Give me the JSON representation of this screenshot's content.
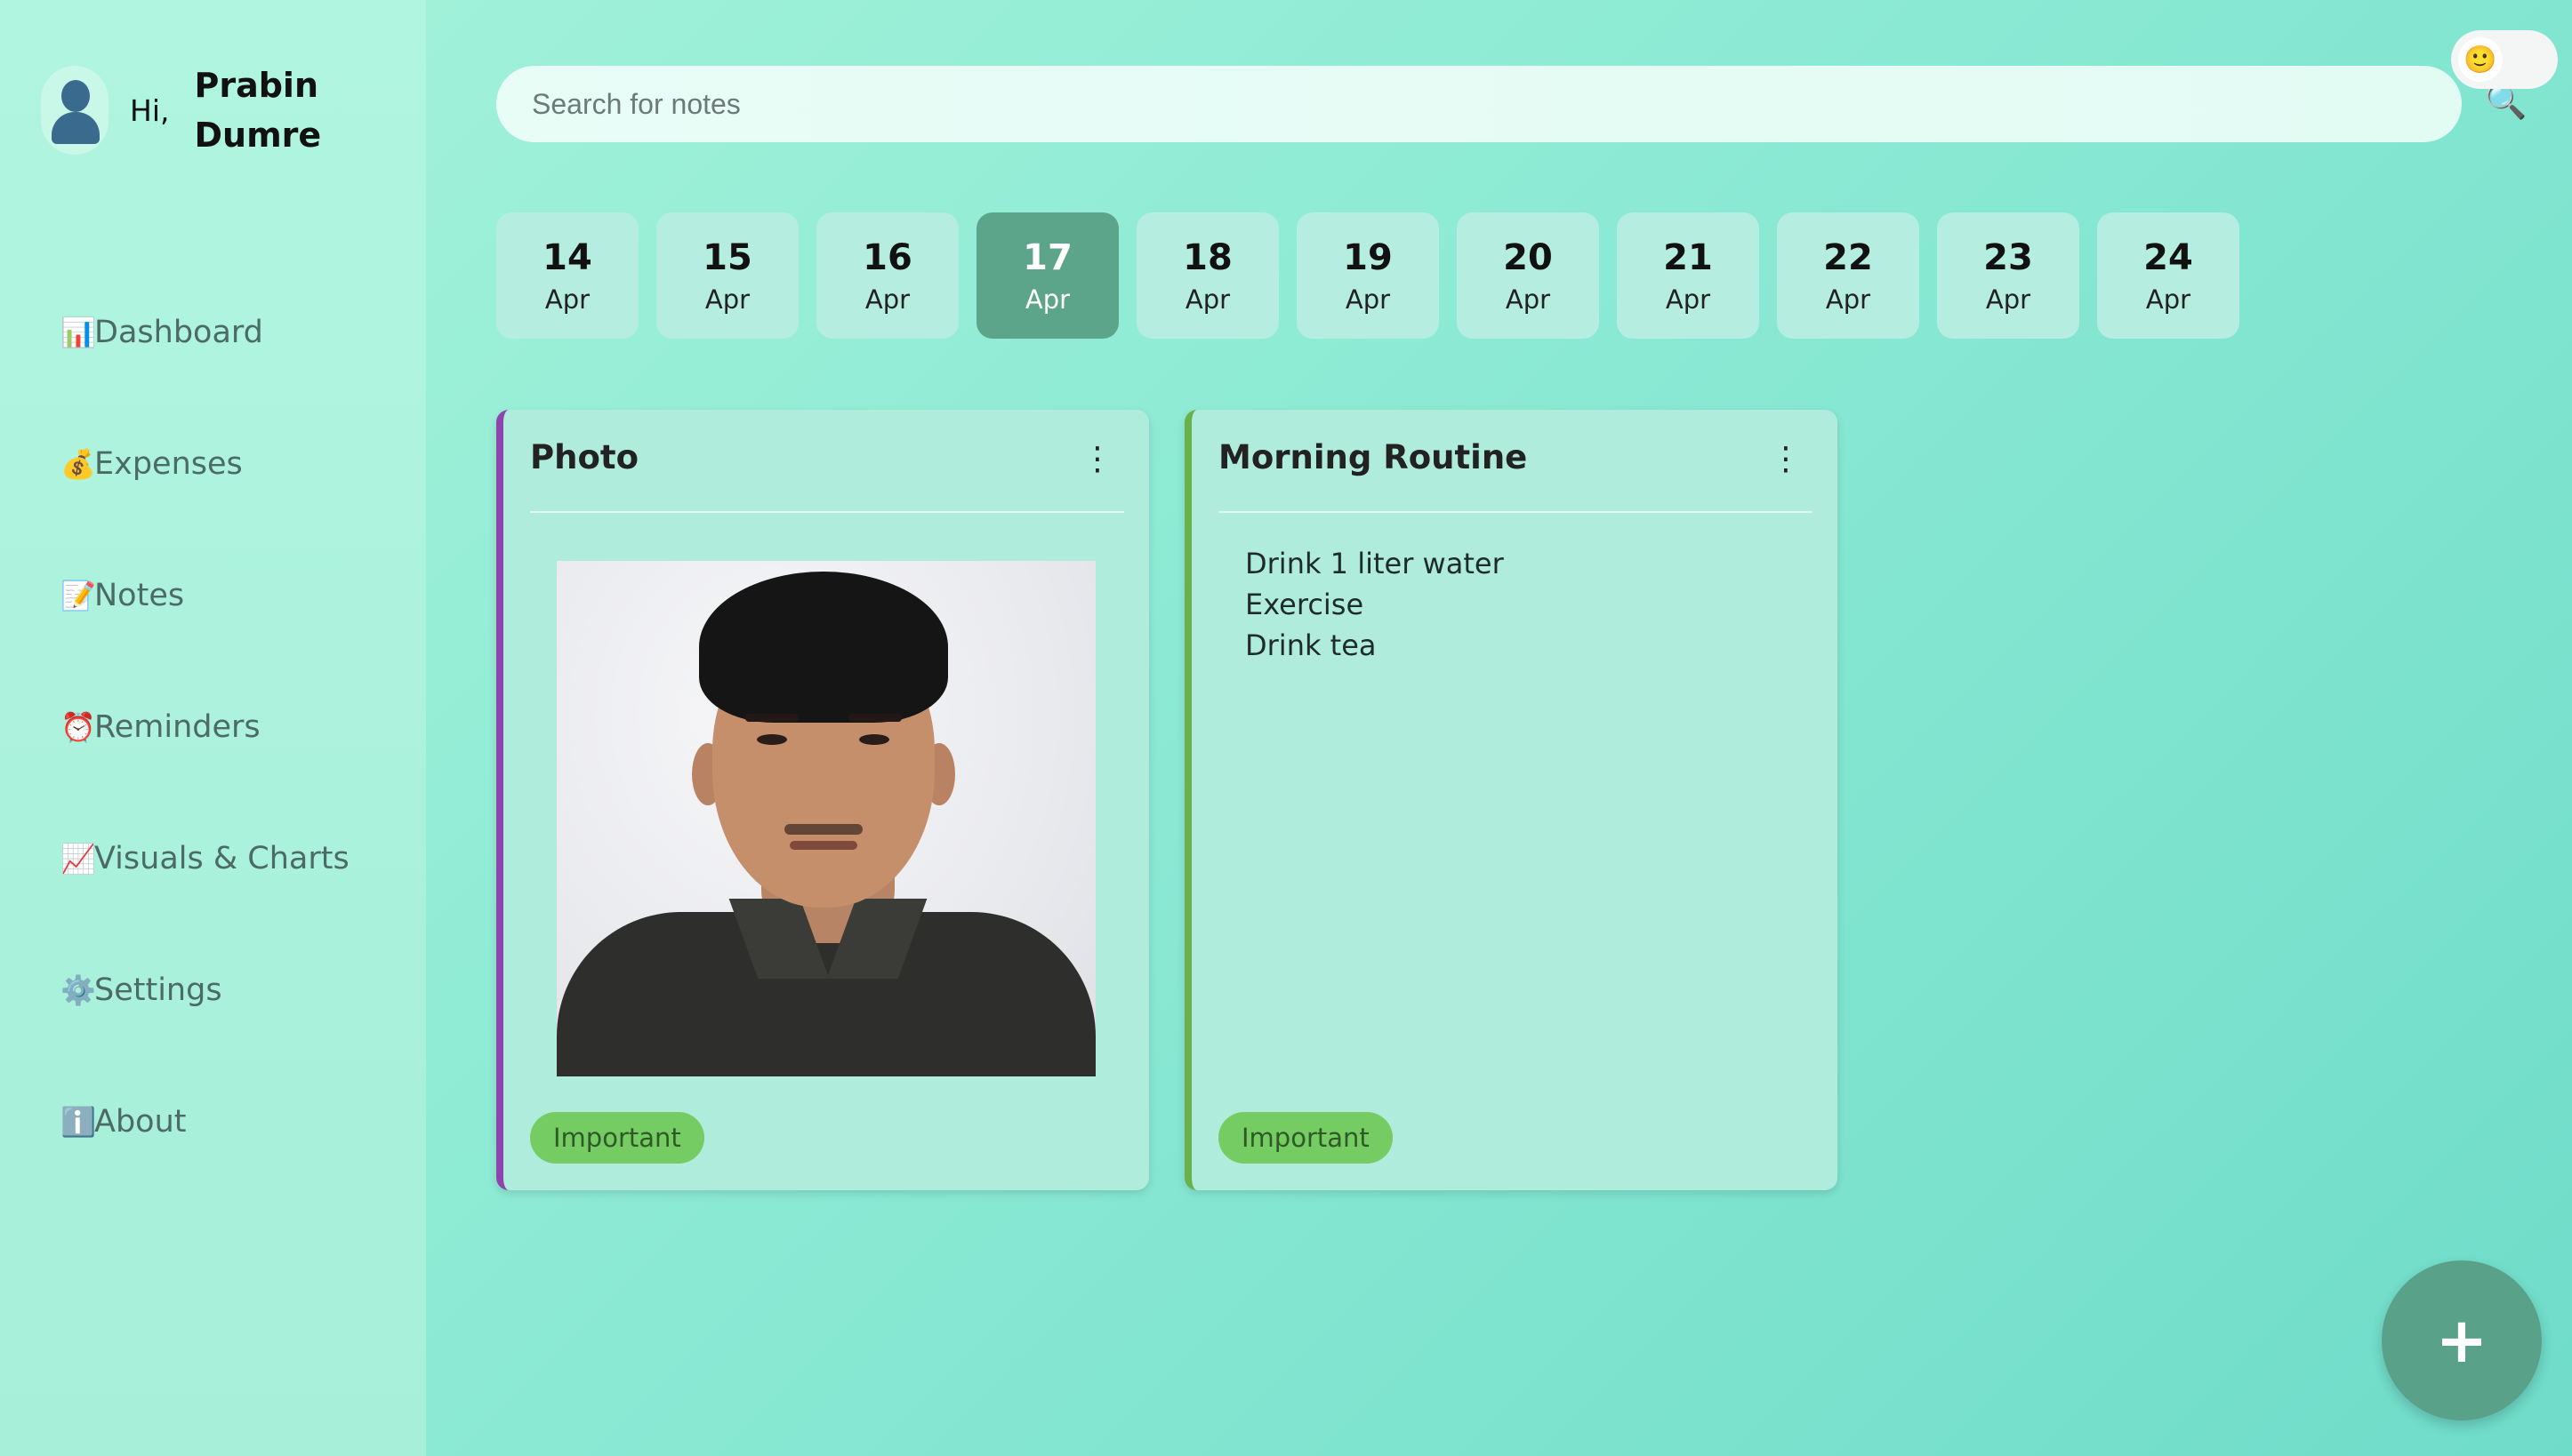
{
  "user": {
    "greeting": "Hi,",
    "name": "Prabin Dumre"
  },
  "nav": [
    {
      "icon": "📊",
      "icon_name": "bar-chart-icon",
      "label": "Dashboard"
    },
    {
      "icon": "💰",
      "icon_name": "money-bag-icon",
      "label": "Expenses"
    },
    {
      "icon": "📝",
      "icon_name": "memo-icon",
      "label": "Notes"
    },
    {
      "icon": "⏰",
      "icon_name": "alarm-clock-icon",
      "label": "Reminders"
    },
    {
      "icon": "📈",
      "icon_name": "line-chart-icon",
      "label": "Visuals & Charts"
    },
    {
      "icon": "⚙️",
      "icon_name": "gear-icon",
      "label": "Settings"
    },
    {
      "icon": "ℹ️",
      "icon_name": "info-icon",
      "label": "About"
    }
  ],
  "search": {
    "placeholder": "Search for notes",
    "icon": "🔍"
  },
  "theme_toggle": {
    "icon": "🙂"
  },
  "dates": [
    {
      "day": "14",
      "month": "Apr"
    },
    {
      "day": "15",
      "month": "Apr"
    },
    {
      "day": "16",
      "month": "Apr"
    },
    {
      "day": "17",
      "month": "Apr",
      "active": true
    },
    {
      "day": "18",
      "month": "Apr"
    },
    {
      "day": "19",
      "month": "Apr"
    },
    {
      "day": "20",
      "month": "Apr"
    },
    {
      "day": "21",
      "month": "Apr"
    },
    {
      "day": "22",
      "month": "Apr"
    },
    {
      "day": "23",
      "month": "Apr"
    },
    {
      "day": "24",
      "month": "Apr"
    }
  ],
  "cards": [
    {
      "title": "Photo",
      "menu": "⋮",
      "tag": "Important",
      "accent": "#8e44ad"
    },
    {
      "title": "Morning Routine",
      "menu": "⋮",
      "tag": "Important",
      "accent": "#6ab04c",
      "items": [
        "Drink 1 liter water",
        "Exercise",
        "Drink tea"
      ]
    }
  ],
  "fab": {
    "label": "+"
  },
  "colors": {
    "active_date": "#5da58a",
    "tag_bg": "#75cc62",
    "fab": "#5aa18a"
  }
}
